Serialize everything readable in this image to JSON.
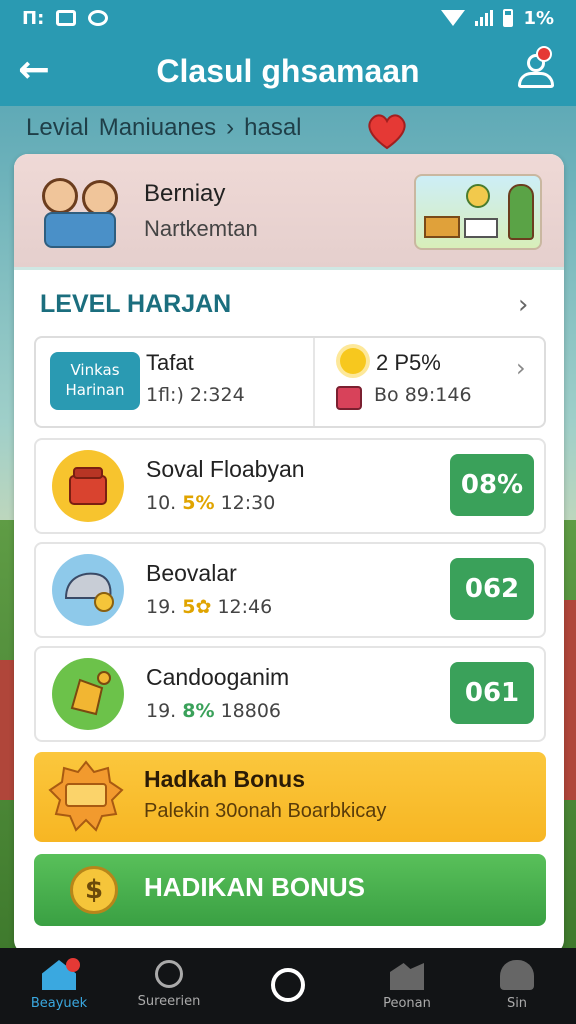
{
  "status_bar": {
    "left_text": "П:",
    "right_text": "1%"
  },
  "header": {
    "title": "Clasul ghsamaan"
  },
  "breadcrumb": {
    "level": "Levial",
    "section": "Maniuanes",
    "separator": "›",
    "current": "hasal"
  },
  "profile": {
    "name": "Berniay",
    "subtitle": "Nartkemtan"
  },
  "section": {
    "title": "LEVEL HARJAN"
  },
  "summary": {
    "badge_line1": "Vinkas",
    "badge_line2": "Harinan",
    "left_title": "Tafat",
    "left_value": "1fl:) 2:324",
    "right_title": "2 P5%",
    "right_value": "Bo 89:146"
  },
  "tasks": [
    {
      "title": "Soval Floabyan",
      "meta_a": "10.",
      "meta_hl": "5%",
      "meta_b": "12:30",
      "badge": "08%",
      "hl_color": "#e0a400"
    },
    {
      "title": "Beovalar",
      "meta_a": "19.",
      "meta_hl": "5✿",
      "meta_b": "12:46",
      "badge": "062",
      "hl_color": "#e0a400"
    },
    {
      "title": "Candooganim",
      "meta_a": "19.",
      "meta_hl": "8%",
      "meta_b": "18806",
      "badge": "061",
      "hl_color": "#3aa15a"
    }
  ],
  "bonus_card": {
    "title": "Hadkah Bonus",
    "subtitle": "Palekin 30onah Boarbkicay"
  },
  "bonus_button": {
    "label": "HADIKAN BONUS",
    "coin_symbol": "$"
  },
  "bottom_nav": [
    {
      "label": "Beayuek"
    },
    {
      "label": "Sureerien"
    },
    {
      "label": ""
    },
    {
      "label": "Peonan"
    },
    {
      "label": "Sin"
    }
  ],
  "colors": {
    "primary": "#2a9ab2",
    "accent_green": "#3aa15a",
    "bonus_yellow": "#fbc73d"
  }
}
